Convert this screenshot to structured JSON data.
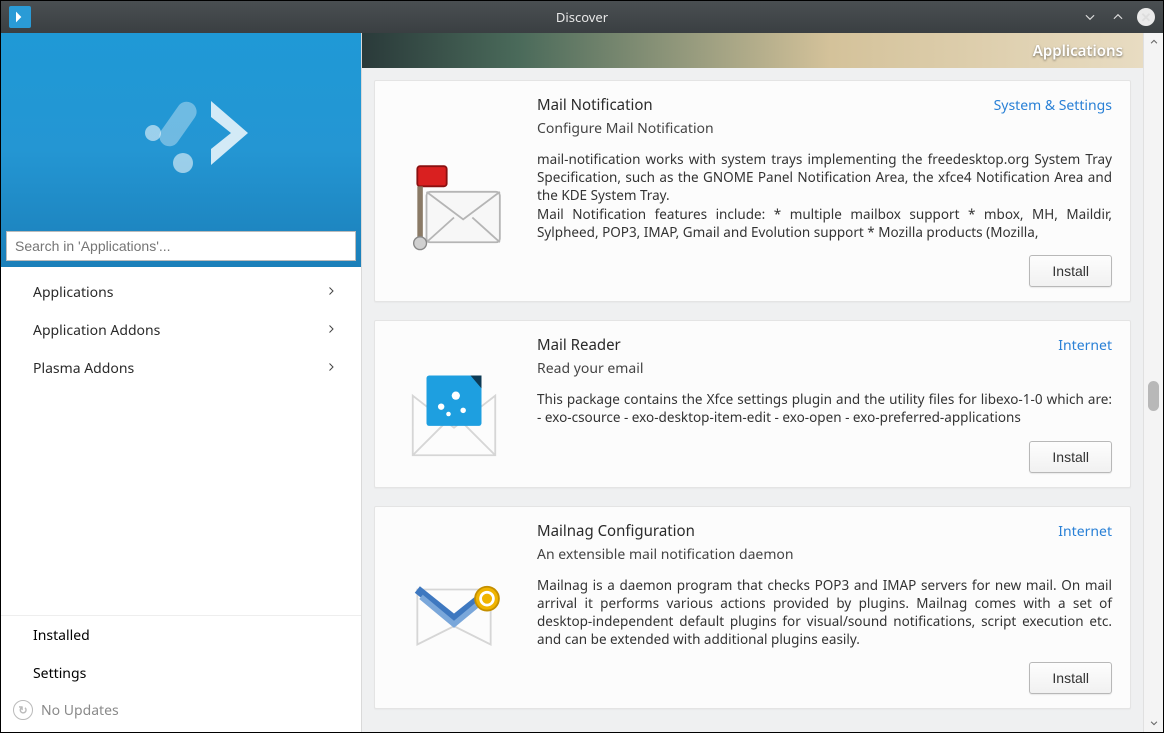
{
  "window": {
    "title": "Discover"
  },
  "sidebar": {
    "search_placeholder": "Search in 'Applications'...",
    "nav": [
      {
        "label": "Applications"
      },
      {
        "label": "Application Addons"
      },
      {
        "label": "Plasma Addons"
      }
    ],
    "bottom": {
      "installed": "Installed",
      "settings": "Settings",
      "updates": "No Updates"
    }
  },
  "main": {
    "breadcrumb": "Applications",
    "install_label": "Install",
    "apps": [
      {
        "title": "Mail Notification",
        "category": "System & Settings",
        "tagline": "Configure Mail Notification",
        "description": "mail-notification works with system trays implementing the freedesktop.org System Tray Specification, such as the GNOME Panel Notification Area, the xfce4 Notification Area and the KDE System Tray.\nMail Notification features include: * multiple mailbox support * mbox, MH, Maildir, Sylpheed, POP3, IMAP, Gmail and Evolution support * Mozilla products (Mozilla,"
      },
      {
        "title": "Mail Reader",
        "category": "Internet",
        "tagline": "Read your email",
        "description": "This package contains the Xfce settings plugin and the utility files for libexo-1-0 which are: - exo-csource - exo-desktop-item-edit - exo-open - exo-preferred-applications"
      },
      {
        "title": "Mailnag Configuration",
        "category": "Internet",
        "tagline": "An extensible mail notification daemon",
        "description": "Mailnag is a daemon program that checks POP3 and IMAP servers for new mail. On mail arrival it performs various actions provided by plugins. Mailnag comes with a set of desktop-independent default plugins for visual/sound notifications, script execution etc. and can be extended with additional plugins easily."
      }
    ]
  }
}
